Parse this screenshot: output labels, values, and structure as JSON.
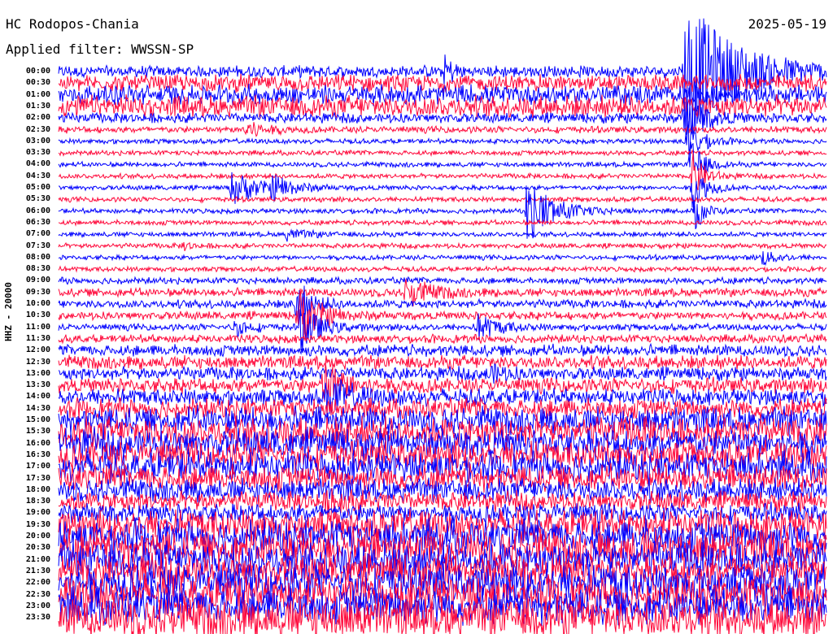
{
  "header": {
    "station": "HC Rodopos-Chania",
    "filter": "Applied filter: WWSSN-SP",
    "date": "2025-05-19",
    "channel_label": "HHZ - 20000"
  },
  "colors": {
    "even_row": "#0000ff",
    "odd_row": "#ff0a3c"
  },
  "chart_data": {
    "type": "line",
    "title": "HC Rodopos-Chania",
    "ylabel": "HHZ - 20000",
    "minutes_per_row": 30,
    "row_labels": [
      "00:00",
      "00:30",
      "01:00",
      "01:30",
      "02:00",
      "02:30",
      "03:00",
      "03:30",
      "04:00",
      "04:30",
      "05:00",
      "05:30",
      "06:00",
      "06:30",
      "07:00",
      "07:30",
      "08:00",
      "08:30",
      "09:00",
      "09:30",
      "10:00",
      "10:30",
      "11:00",
      "11:30",
      "12:00",
      "12:30",
      "13:00",
      "13:30",
      "14:00",
      "14:30",
      "15:00",
      "15:30",
      "16:00",
      "16:30",
      "17:00",
      "17:30",
      "18:00",
      "18:30",
      "19:00",
      "19:30",
      "20:00",
      "20:30",
      "21:00",
      "21:30",
      "22:00",
      "22:30",
      "23:00",
      "23:30"
    ],
    "noise_amplitude": [
      7,
      10,
      12,
      13,
      6,
      4,
      3,
      3,
      3,
      3,
      3,
      3,
      3,
      3,
      3,
      3,
      3,
      3,
      4,
      5,
      5,
      5,
      4,
      5,
      7,
      8,
      8,
      9,
      10,
      12,
      16,
      18,
      18,
      17,
      18,
      16,
      14,
      12,
      12,
      18,
      20,
      22,
      22,
      20,
      22,
      22,
      22,
      24
    ],
    "events": [
      {
        "row": 0,
        "minute": 24.5,
        "amplitude": 85,
        "duration": 3.5
      },
      {
        "row": 0,
        "minute": 15.1,
        "amplitude": 18,
        "duration": 0.6
      },
      {
        "row": 5,
        "minute": 7.3,
        "amplitude": 12,
        "duration": 1.2
      },
      {
        "row": 4,
        "minute": 24.5,
        "amplitude": 30,
        "duration": 1.2
      },
      {
        "row": 6,
        "minute": 24.6,
        "amplitude": 25,
        "duration": 1.0
      },
      {
        "row": 8,
        "minute": 24.7,
        "amplitude": 30,
        "duration": 0.8
      },
      {
        "row": 9,
        "minute": 24.8,
        "amplitude": 28,
        "duration": 0.8
      },
      {
        "row": 10,
        "minute": 6.8,
        "amplitude": 22,
        "duration": 1.6
      },
      {
        "row": 10,
        "minute": 8.4,
        "amplitude": 14,
        "duration": 1.3
      },
      {
        "row": 10,
        "minute": 24.8,
        "amplitude": 30,
        "duration": 0.8
      },
      {
        "row": 12,
        "minute": 18.3,
        "amplitude": 40,
        "duration": 1.8
      },
      {
        "row": 12,
        "minute": 24.9,
        "amplitude": 25,
        "duration": 0.6
      },
      {
        "row": 14,
        "minute": 8.9,
        "amplitude": 6,
        "duration": 1.4
      },
      {
        "row": 15,
        "minute": 4.9,
        "amplitude": 5,
        "duration": 0.6
      },
      {
        "row": 16,
        "minute": 27.5,
        "amplitude": 9,
        "duration": 1.0
      },
      {
        "row": 19,
        "minute": 13.6,
        "amplitude": 18,
        "duration": 1.6
      },
      {
        "row": 20,
        "minute": 9.3,
        "amplitude": 30,
        "duration": 1.0
      },
      {
        "row": 21,
        "minute": 9.4,
        "amplitude": 35,
        "duration": 1.4
      },
      {
        "row": 22,
        "minute": 9.5,
        "amplitude": 30,
        "duration": 1.2
      },
      {
        "row": 22,
        "minute": 6.9,
        "amplitude": 10,
        "duration": 1.0
      },
      {
        "row": 22,
        "minute": 16.4,
        "amplitude": 15,
        "duration": 1.4
      },
      {
        "row": 27,
        "minute": 10.4,
        "amplitude": 30,
        "duration": 1.3
      },
      {
        "row": 28,
        "minute": 10.5,
        "amplitude": 22,
        "duration": 1.5
      },
      {
        "row": 26,
        "minute": 16.8,
        "amplitude": 10,
        "duration": 1.0
      },
      {
        "row": 37,
        "minute": 10.6,
        "amplitude": 18,
        "duration": 1.0
      }
    ]
  }
}
